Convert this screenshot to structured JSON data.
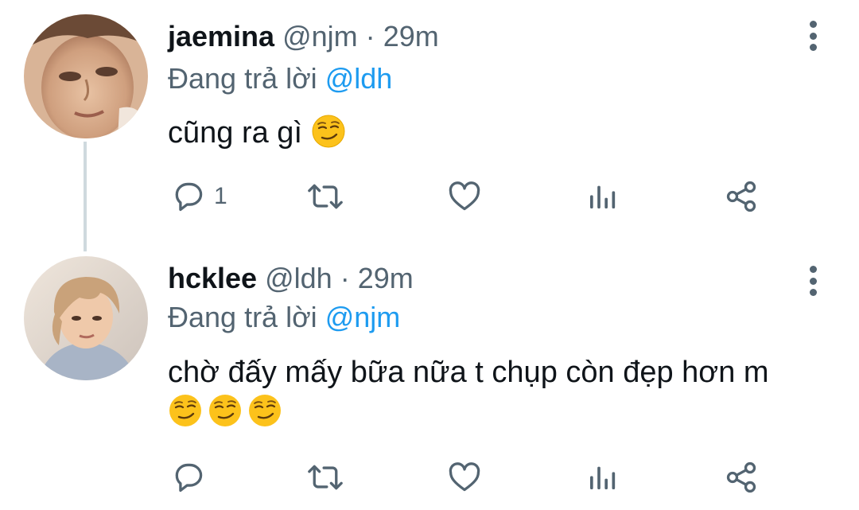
{
  "tweets": [
    {
      "display_name": "jaemina",
      "handle": "@njm",
      "separator": "·",
      "time": "29m",
      "reply_prefix": "Đang trả lời ",
      "reply_target": "@ldh",
      "text_lines": [
        "cũng ra gì"
      ],
      "emoji": "smirking-face",
      "emoji_count_line1": 1,
      "emoji_count_line2": 0,
      "reply_count": "1",
      "avatar_icon": "avatar-photo"
    },
    {
      "display_name": "hcklee",
      "handle": "@ldh",
      "separator": "·",
      "time": "29m",
      "reply_prefix": "Đang trả lời ",
      "reply_target": "@njm",
      "text_lines": [
        "chờ đấy mấy bữa nữa t chụp còn đẹp hơn m"
      ],
      "emoji": "smirking-face",
      "emoji_count_line1": 0,
      "emoji_count_line2": 3,
      "reply_count": "",
      "avatar_icon": "avatar-photo"
    }
  ],
  "colors": {
    "text_primary": "#0f1419",
    "text_secondary": "#536471",
    "link": "#1d9bf0",
    "thread_line": "#cfd9de"
  },
  "icons": [
    "reply-icon",
    "retweet-icon",
    "like-icon",
    "stats-icon",
    "share-icon",
    "more-options-icon"
  ]
}
